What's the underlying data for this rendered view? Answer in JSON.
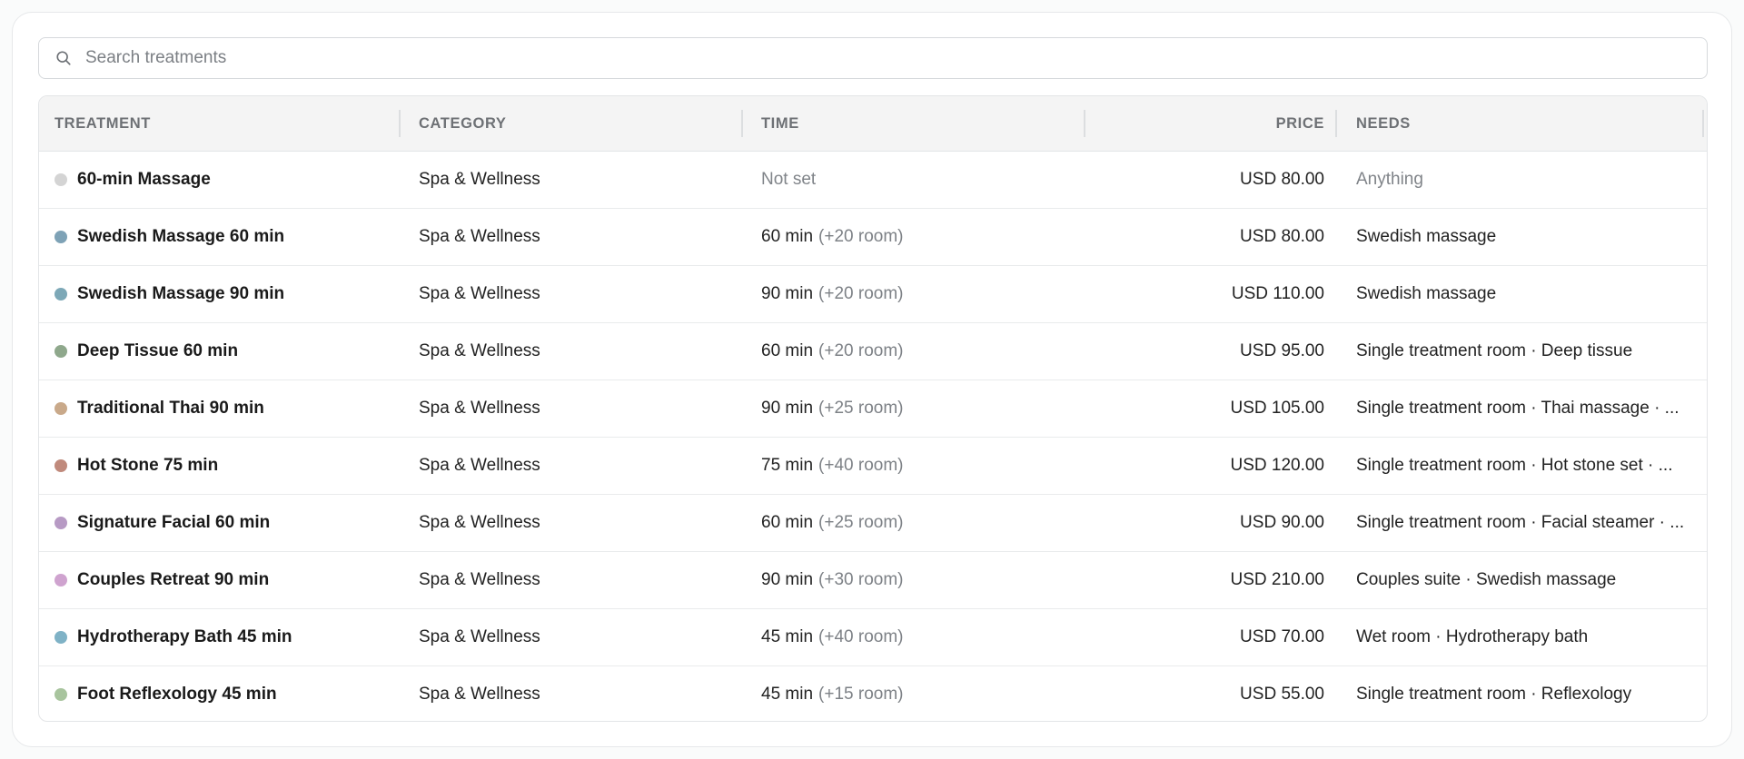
{
  "search": {
    "placeholder": "Search treatments",
    "value": ""
  },
  "table": {
    "columns": {
      "treatment": "TREATMENT",
      "category": "CATEGORY",
      "time": "TIME",
      "price": "PRICE",
      "needs": "NEEDS"
    },
    "rows": [
      {
        "color": "#d4d4d4",
        "name": "60-min Massage",
        "category": "Spa & Wellness",
        "time": "Not set",
        "room": "",
        "price": "USD 80.00",
        "needs": "Anything",
        "time_muted": true,
        "needs_muted": true
      },
      {
        "color": "#7ea2b6",
        "name": "Swedish Massage 60 min",
        "category": "Spa & Wellness",
        "time": "60 min",
        "room": "(+20 room)",
        "price": "USD 80.00",
        "needs": "Swedish massage",
        "time_muted": false,
        "needs_muted": false
      },
      {
        "color": "#7da8b7",
        "name": "Swedish Massage 90 min",
        "category": "Spa & Wellness",
        "time": "90 min",
        "room": "(+20 room)",
        "price": "USD 110.00",
        "needs": "Swedish massage",
        "time_muted": false,
        "needs_muted": false
      },
      {
        "color": "#8fa88c",
        "name": "Deep Tissue 60 min",
        "category": "Spa & Wellness",
        "time": "60 min",
        "room": "(+20 room)",
        "price": "USD 95.00",
        "needs": "Single treatment room · Deep tissue",
        "time_muted": false,
        "needs_muted": false
      },
      {
        "color": "#c9a98a",
        "name": "Traditional Thai 90 min",
        "category": "Spa & Wellness",
        "time": "90 min",
        "room": "(+25 room)",
        "price": "USD 105.00",
        "needs": "Single treatment room · Thai massage · ...",
        "time_muted": false,
        "needs_muted": false
      },
      {
        "color": "#c08a7c",
        "name": "Hot Stone 75 min",
        "category": "Spa & Wellness",
        "time": "75 min",
        "room": "(+40 room)",
        "price": "USD 120.00",
        "needs": "Single treatment room · Hot stone set · ...",
        "time_muted": false,
        "needs_muted": false
      },
      {
        "color": "#b79ac4",
        "name": "Signature Facial 60 min",
        "category": "Spa & Wellness",
        "time": "60 min",
        "room": "(+25 room)",
        "price": "USD 90.00",
        "needs": "Single treatment room · Facial steamer · ...",
        "time_muted": false,
        "needs_muted": false
      },
      {
        "color": "#cfa3cf",
        "name": "Couples Retreat 90 min",
        "category": "Spa & Wellness",
        "time": "90 min",
        "room": "(+30 room)",
        "price": "USD 210.00",
        "needs": "Couples suite · Swedish massage",
        "time_muted": false,
        "needs_muted": false
      },
      {
        "color": "#7fb2c6",
        "name": "Hydrotherapy Bath 45 min",
        "category": "Spa & Wellness",
        "time": "45 min",
        "room": "(+40 room)",
        "price": "USD 70.00",
        "needs": "Wet room · Hydrotherapy bath",
        "time_muted": false,
        "needs_muted": false
      },
      {
        "color": "#a8c49e",
        "name": "Foot Reflexology 45 min",
        "category": "Spa & Wellness",
        "time": "45 min",
        "room": "(+15 room)",
        "price": "USD 55.00",
        "needs": "Single treatment room · Reflexology",
        "time_muted": false,
        "needs_muted": false
      }
    ]
  }
}
